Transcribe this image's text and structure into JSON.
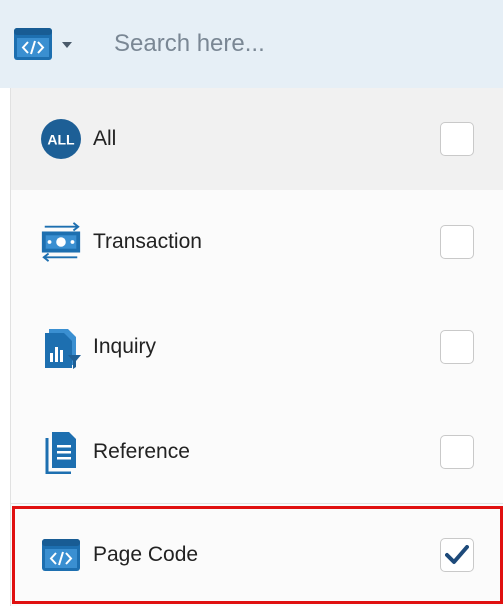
{
  "search": {
    "placeholder": "Search here...",
    "type_icon": "page-code-icon"
  },
  "menu": {
    "items": [
      {
        "label": "All",
        "icon": "all-badge-icon",
        "checked": false
      },
      {
        "label": "Transaction",
        "icon": "transaction-icon",
        "checked": false
      },
      {
        "label": "Inquiry",
        "icon": "inquiry-icon",
        "checked": false
      },
      {
        "label": "Reference",
        "icon": "reference-icon",
        "checked": false
      },
      {
        "label": "Page Code",
        "icon": "page-code-icon",
        "checked": true
      }
    ]
  },
  "all_badge_text": "ALL",
  "colors": {
    "icon_blue": "#1d5f96",
    "header_bg": "#e6eff6",
    "highlight": "#e01010"
  }
}
